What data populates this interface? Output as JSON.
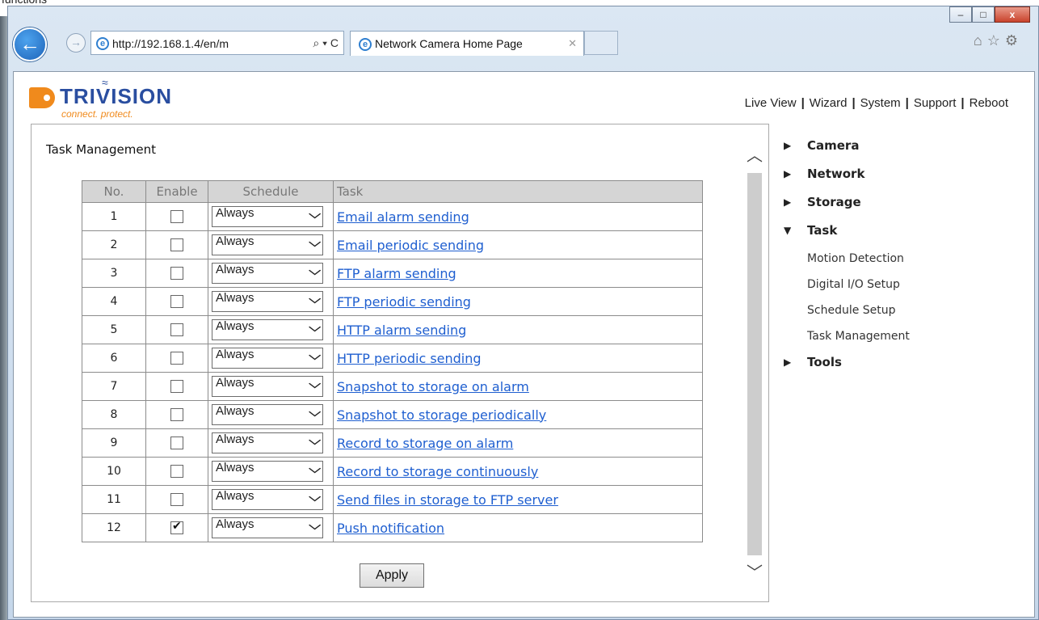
{
  "browser": {
    "top_text": "functions",
    "window_buttons": {
      "minimize": "–",
      "maximize": "□",
      "close": "x"
    },
    "back_glyph": "←",
    "forward_glyph": "→",
    "address": "http://192.168.1.4/en/m",
    "address_tools": "⌕ ▾ C",
    "tab_title": "Network Camera Home Page",
    "tab_close": "✕",
    "icons": [
      "home-icon",
      "favorites-icon",
      "settings-icon"
    ]
  },
  "brand": {
    "name": "TRIVISION",
    "tagline": "connect. protect."
  },
  "topnav": [
    {
      "label": "Live View"
    },
    {
      "label": "Wizard"
    },
    {
      "label": "System"
    },
    {
      "label": "Support"
    },
    {
      "label": "Reboot"
    }
  ],
  "topnav_separator": "|",
  "panel": {
    "title": "Task Management",
    "columns": {
      "no": "No.",
      "enable": "Enable",
      "schedule": "Schedule",
      "task": "Task"
    },
    "rows": [
      {
        "no": "1",
        "enabled": false,
        "schedule": "Always",
        "task": "Email alarm sending"
      },
      {
        "no": "2",
        "enabled": false,
        "schedule": "Always",
        "task": "Email periodic sending"
      },
      {
        "no": "3",
        "enabled": false,
        "schedule": "Always",
        "task": "FTP alarm sending"
      },
      {
        "no": "4",
        "enabled": false,
        "schedule": "Always",
        "task": "FTP periodic sending"
      },
      {
        "no": "5",
        "enabled": false,
        "schedule": "Always",
        "task": "HTTP alarm sending"
      },
      {
        "no": "6",
        "enabled": false,
        "schedule": "Always",
        "task": "HTTP periodic sending"
      },
      {
        "no": "7",
        "enabled": false,
        "schedule": "Always",
        "task": "Snapshot to storage on alarm"
      },
      {
        "no": "8",
        "enabled": false,
        "schedule": "Always",
        "task": "Snapshot to storage periodically"
      },
      {
        "no": "9",
        "enabled": false,
        "schedule": "Always",
        "task": "Record to storage on alarm"
      },
      {
        "no": "10",
        "enabled": false,
        "schedule": "Always",
        "task": "Record to storage continuously"
      },
      {
        "no": "11",
        "enabled": false,
        "schedule": "Always",
        "task": "Send files in storage to FTP server"
      },
      {
        "no": "12",
        "enabled": true,
        "schedule": "Always",
        "task": "Push notification"
      }
    ],
    "apply_label": "Apply"
  },
  "sidebar": {
    "camera": "Camera",
    "network": "Network",
    "storage": "Storage",
    "task": "Task",
    "task_sub": [
      "Motion Detection",
      "Digital I/O Setup",
      "Schedule Setup",
      "Task Management"
    ],
    "tools": "Tools"
  },
  "colors": {
    "accent": "#f08a1c",
    "brand_blue": "#2a4ea0",
    "link": "#1f5fd0"
  }
}
